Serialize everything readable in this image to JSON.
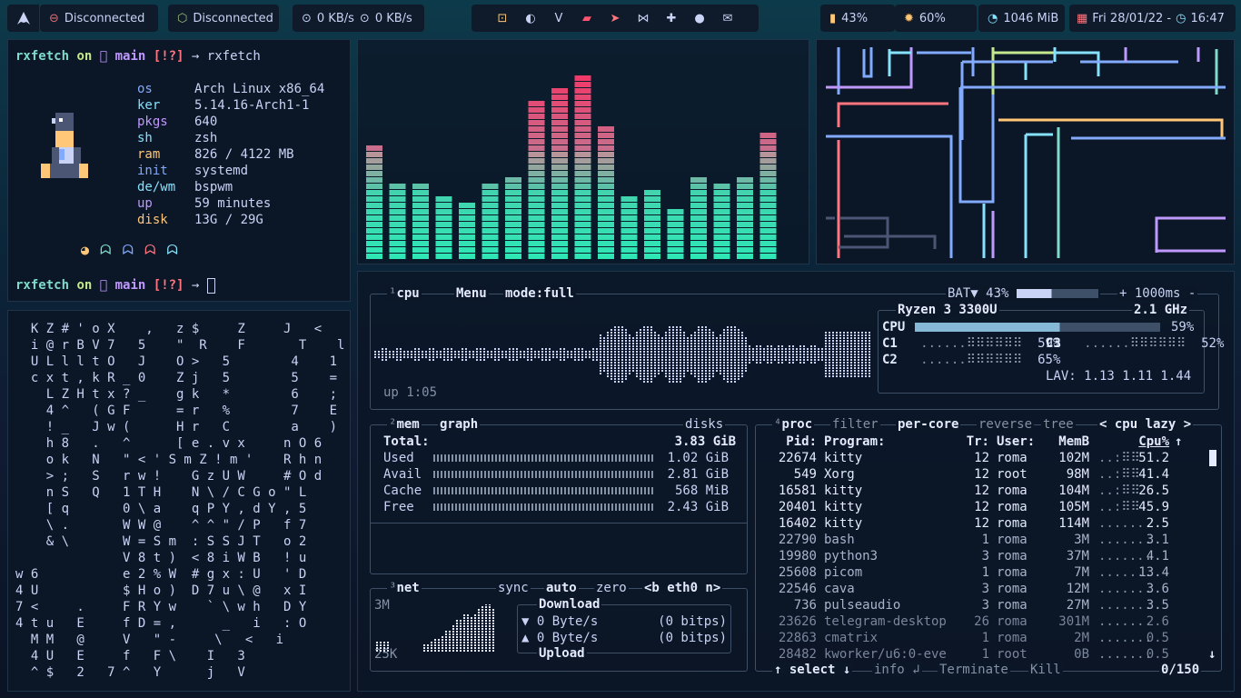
{
  "topbar": {
    "net1": "Disconnected",
    "net2": "Disconnected",
    "down": "0 KB/s",
    "up": "0 KB/s",
    "bat": "43%",
    "brightness": "60%",
    "mem": "1046 MiB",
    "date": "Fri 28/01/22 -",
    "time": "16:47",
    "apps": [
      "terminal-icon",
      "firefox-icon",
      "vim-icon",
      "files-icon",
      "telegram-icon",
      "vscode-icon",
      "python-icon",
      "github-icon",
      "mail-icon"
    ]
  },
  "rxfetch": {
    "cmd_user": "rxfetch",
    "on": "on",
    "branch": " main",
    "status": "[!?]",
    "cmd": "→ rxfetch",
    "arrow": "→",
    "info": [
      {
        "k": "os",
        "v": "Arch Linux x86_64",
        "c": "#82aaff"
      },
      {
        "k": "ker",
        "v": "5.14.16-Arch1-1",
        "c": "#86e1fc"
      },
      {
        "k": "pkgs",
        "v": "640",
        "c": "#c099ff"
      },
      {
        "k": "sh",
        "v": "zsh",
        "c": "#86e1fc"
      },
      {
        "k": "ram",
        "v": "826 / 4122 MB",
        "c": "#ffc777"
      },
      {
        "k": "init",
        "v": "systemd",
        "c": "#82aaff"
      },
      {
        "k": "de/wm",
        "v": "bspwm",
        "c": "#86e1fc"
      },
      {
        "k": "up",
        "v": "59 minutes",
        "c": "#c099ff"
      },
      {
        "k": "disk",
        "v": "13G / 29G",
        "c": "#ffc777"
      }
    ]
  },
  "rain_lines": [
    "  K Z # ' o X    ,   z $     Z     J   <",
    "  i @ r B V 7   5    \"  R    F       T    l",
    "  U L l l t O   J    O >   5        4    1",
    "  c x t , k R _ 0    Z j   5        5    =",
    "    L Z H t x ? _    g k   *        6    ;",
    "    4 ^   ( G F      = r   %        7    E",
    "    ! _   J w (      H r   C        a    )",
    "    h 8   .   ^      [ e . v x     n O 6",
    "    o k   N   \" < ' S m Z ! m '    R h n",
    "    > ;   S   r w !    G z U W     # O d",
    "    n S   Q   1 T H    N \\ / C G o \" L",
    "    [ q       0 \\ a    q P Y , d Y , 5",
    "    \\ .       W W @    ^ ^ \" / P   f 7",
    "    & \\       W = S m  : S S J T   o 2",
    "              V 8 t )  < 8 i W B   ! u",
    "w 6           e 2 % W  # g x : U   ' D",
    "4 U           $ H o )  D 7 u \\ @   x I",
    "7 <     .     F R Y w    ` \\ w h   D Y",
    "4 t u   E     f D = ,      _   i   : O",
    "  M M   @     V   \" -     \\   <   i",
    "  4 U   E     f   F \\    I   3",
    "  ^ $   2   7 ^   Y      j   V"
  ],
  "visualizer": {
    "values": [
      0.58,
      0.39,
      0.37,
      0.32,
      0.29,
      0.39,
      0.41,
      0.79,
      0.84,
      0.9,
      0.65,
      0.32,
      0.35,
      0.26,
      0.42,
      0.38,
      0.4,
      0.63
    ]
  },
  "cpu": {
    "label_num": "¹",
    "label": "cpu",
    "menu": "Menu",
    "mode": "mode:full",
    "bat": "BAT▼ 43%",
    "rate": "+ 1000ms -",
    "model": "Ryzen 3 3300U",
    "freq": "2.1 GHz",
    "total_label": "CPU",
    "total": "59%",
    "c1": "C1",
    "c1v": "59%",
    "c2": "C2",
    "c2v": "65%",
    "c3": "C3",
    "c3v": "52%",
    "lav": "LAV: 1.13 1.11 1.44",
    "uptime": "up 1:05",
    "total_frac": 0.59
  },
  "mem": {
    "num": "²",
    "label": "mem",
    "graph": "graph",
    "disks": "disks",
    "total_k": "Total:",
    "total_v": "3.83 GiB",
    "rows": [
      {
        "k": "Used",
        "v": "1.02 GiB"
      },
      {
        "k": "Avail",
        "v": "2.81 GiB"
      },
      {
        "k": "Cache",
        "v": "568 MiB"
      },
      {
        "k": "Free",
        "v": "2.43 GiB"
      }
    ]
  },
  "net": {
    "num": "³",
    "label": "net",
    "sync": "sync",
    "auto": "auto",
    "zero": "zero",
    "iface": "<b eth0 n>",
    "max": "3M",
    "min": "25K",
    "download": "Download",
    "upload": "Upload",
    "down_rate": "▼ 0 Byte/s",
    "down_bits": "(0 bitps)",
    "up_rate": "▲ 0 Byte/s",
    "up_bits": "(0 bitps)"
  },
  "proc": {
    "num": "⁴",
    "label": "proc",
    "filter": "filter",
    "percore": "per-core",
    "reverse": "reverse",
    "tree": "tree",
    "sort": "< cpu lazy >",
    "headers": {
      "pid": "Pid:",
      "prog": "Program:",
      "tr": "Tr:",
      "user": "User:",
      "mem": "MemB",
      "cpu": "Cpu%"
    },
    "rows": [
      {
        "pid": "22674",
        "prog": "kitty",
        "tr": "12",
        "user": "roma",
        "mem": "102M",
        "cpu": "51.2"
      },
      {
        "pid": "549",
        "prog": "Xorg",
        "tr": "12",
        "user": "root",
        "mem": "98M",
        "cpu": "41.4"
      },
      {
        "pid": "16581",
        "prog": "kitty",
        "tr": "12",
        "user": "roma",
        "mem": "104M",
        "cpu": "26.5"
      },
      {
        "pid": "20401",
        "prog": "kitty",
        "tr": "12",
        "user": "roma",
        "mem": "105M",
        "cpu": "45.9"
      },
      {
        "pid": "16402",
        "prog": "kitty",
        "tr": "12",
        "user": "roma",
        "mem": "114M",
        "cpu": "2.5"
      },
      {
        "pid": "22790",
        "prog": "bash",
        "tr": "1",
        "user": "roma",
        "mem": "3M",
        "cpu": "3.1"
      },
      {
        "pid": "19980",
        "prog": "python3",
        "tr": "3",
        "user": "roma",
        "mem": "37M",
        "cpu": "4.1"
      },
      {
        "pid": "25608",
        "prog": "picom",
        "tr": "1",
        "user": "roma",
        "mem": "7M",
        "cpu": "13.4"
      },
      {
        "pid": "22546",
        "prog": "cava",
        "tr": "3",
        "user": "roma",
        "mem": "12M",
        "cpu": "3.6"
      },
      {
        "pid": "736",
        "prog": "pulseaudio",
        "tr": "3",
        "user": "roma",
        "mem": "27M",
        "cpu": "3.5"
      },
      {
        "pid": "23626",
        "prog": "telegram-desktop",
        "tr": "26",
        "user": "roma",
        "mem": "301M",
        "cpu": "2.6"
      },
      {
        "pid": "22863",
        "prog": "cmatrix",
        "tr": "1",
        "user": "roma",
        "mem": "2M",
        "cpu": "0.5"
      },
      {
        "pid": "28482",
        "prog": "kworker/u6:0-eve",
        "tr": "1",
        "user": "root",
        "mem": "0B",
        "cpu": "0.5"
      }
    ],
    "select": "↑ select ↓",
    "info": "info ↲",
    "terminate": "Terminate",
    "kill": "Kill",
    "count": "0/150"
  }
}
